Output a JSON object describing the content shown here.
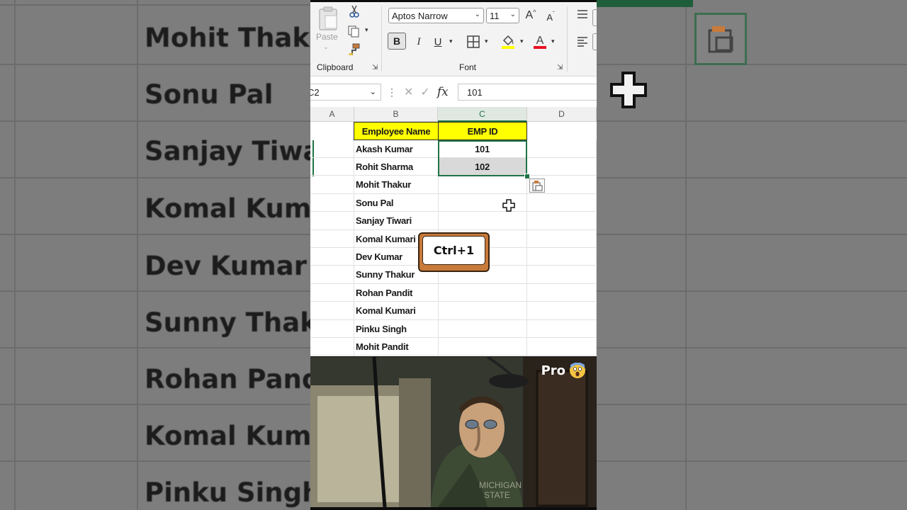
{
  "background": {
    "left_names": [
      "Mohit Thakur",
      "Sonu Pal",
      "Sanjay Tiwari",
      "Komal Kumar",
      "Dev Kumar",
      "Sunny Thaku",
      "Rohan Pandit",
      "Komal Kuma",
      "Pinku Singh"
    ]
  },
  "ribbon": {
    "clipboard_label": "Clipboard",
    "paste_label": "Paste",
    "font_label": "Font",
    "font_name": "Aptos Narrow",
    "font_size": "11",
    "grow_font": "A",
    "shrink_font": "A",
    "bold": "B",
    "italic": "I",
    "underline": "U",
    "font_color_glyph": "A",
    "highlight_color": "#ffff00",
    "font_color": "#e81123"
  },
  "formula_bar": {
    "name_box": "C2",
    "formula_value": "101"
  },
  "columns": [
    "A",
    "B",
    "C",
    "D"
  ],
  "table": {
    "header_name": "Employee Name",
    "header_id": "EMP ID",
    "header_color": "#ffff00",
    "rows": [
      {
        "name": "Akash Kumar",
        "id": "101"
      },
      {
        "name": "Rohit Sharma",
        "id": "102"
      },
      {
        "name": "Mohit Thakur",
        "id": ""
      },
      {
        "name": "Sonu Pal",
        "id": ""
      },
      {
        "name": "Sanjay Tiwari",
        "id": ""
      },
      {
        "name": "Komal Kumari",
        "id": ""
      },
      {
        "name": "Dev Kumar",
        "id": ""
      },
      {
        "name": "Sunny Thakur",
        "id": ""
      },
      {
        "name": "Rohan Pandit",
        "id": ""
      },
      {
        "name": "Komal Kumari",
        "id": ""
      },
      {
        "name": "Pinku Singh",
        "id": ""
      },
      {
        "name": "Mohit Pandit",
        "id": ""
      }
    ]
  },
  "shortcut_key": "Ctrl+1",
  "video": {
    "caption": "Pro"
  },
  "colors": {
    "excel_green": "#217346",
    "keycap_orange": "#c87a3a"
  }
}
